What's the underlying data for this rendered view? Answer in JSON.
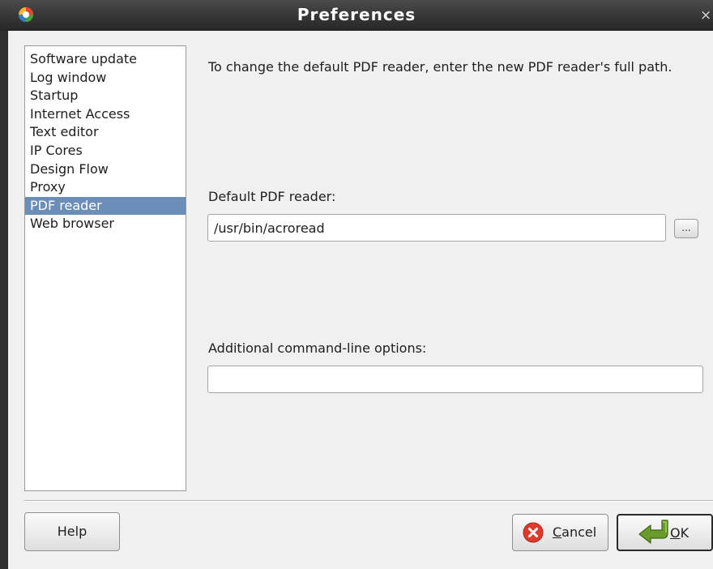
{
  "window": {
    "title": "Preferences",
    "close_glyph": "×",
    "app_icon": "app-logo-icon"
  },
  "sidebar": {
    "selected_index": 8,
    "items": [
      {
        "label": "Software update"
      },
      {
        "label": "Log window"
      },
      {
        "label": "Startup"
      },
      {
        "label": "Internet Access"
      },
      {
        "label": "Text editor"
      },
      {
        "label": "IP Cores"
      },
      {
        "label": "Design Flow"
      },
      {
        "label": "Proxy"
      },
      {
        "label": "PDF reader"
      },
      {
        "label": "Web browser"
      }
    ]
  },
  "main": {
    "description": "To change the default PDF reader, enter the new PDF reader's full path.",
    "reader_label": "Default PDF reader:",
    "reader_value": "/usr/bin/acroread",
    "browse_label": "...",
    "options_label": "Additional command-line options:",
    "options_value": ""
  },
  "buttons": {
    "help": "Help",
    "cancel_mnemonic": "C",
    "cancel_rest": "ancel",
    "ok_mnemonic": "O",
    "ok_rest": "K"
  },
  "colors": {
    "selection": "#6b8eb8",
    "titlebar": "#333333",
    "cancel_icon": "#e03a2e",
    "ok_icon": "#6a9a2c"
  },
  "icons": {
    "cancel": "cancel-x-icon",
    "ok": "ok-arrow-icon"
  }
}
